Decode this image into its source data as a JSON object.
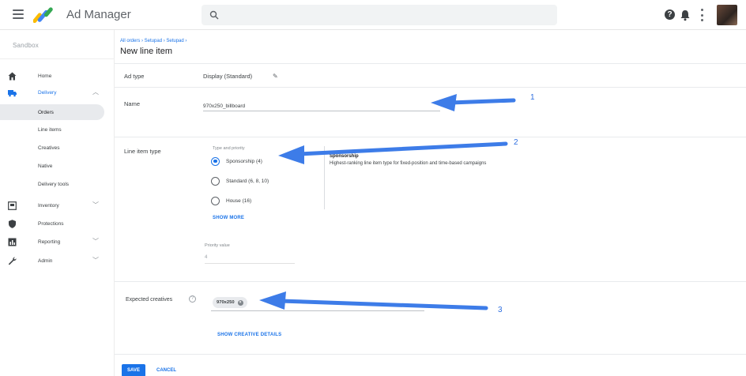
{
  "header": {
    "app_name": "Ad Manager",
    "help_icon_glyph": "?"
  },
  "sidebar": {
    "network": "Sandbox",
    "items": [
      {
        "label": "Home",
        "icon": "home-icon"
      },
      {
        "label": "Delivery",
        "icon": "delivery-truck-icon"
      },
      {
        "label": "Orders"
      },
      {
        "label": "Line items"
      },
      {
        "label": "Creatives"
      },
      {
        "label": "Native"
      },
      {
        "label": "Delivery tools"
      },
      {
        "label": "Inventory",
        "icon": "inventory-icon"
      },
      {
        "label": "Protections",
        "icon": "shield-icon"
      },
      {
        "label": "Reporting",
        "icon": "reporting-icon"
      },
      {
        "label": "Admin",
        "icon": "wrench-icon"
      }
    ]
  },
  "main": {
    "breadcrumb": "All orders › Setupad › Setupad ›",
    "title": "New line item",
    "ad_type_label": "Ad type",
    "ad_type_value": "Display (Standard)",
    "pencil_glyph": "✎",
    "name_label": "Name",
    "name_value": "970x250_billboard",
    "line_item_type_label": "Line item type",
    "type_priority_label": "Type and priority",
    "options": [
      {
        "label": "Sponsorship (4)",
        "checked": true
      },
      {
        "label": "Standard (6, 8, 10)",
        "checked": false
      },
      {
        "label": "House (16)",
        "checked": false
      }
    ],
    "show_more": "SHOW MORE",
    "desc_title": "Sponsorship",
    "desc_text": "Highest-ranking line item type for fixed-position and time-based campaigns",
    "priority_label": "Priority value",
    "priority_value": "4",
    "expected_creatives_label": "Expected creatives",
    "info_glyph": "?",
    "chip": "970x250",
    "chip_remove_glyph": "×",
    "show_creative_details": "SHOW CREATIVE DETAILS",
    "save": "SAVE",
    "cancel": "CANCEL"
  },
  "annotations": {
    "one": "1",
    "two": "2",
    "three": "3",
    "arrow_color": "#2f6fe0"
  }
}
